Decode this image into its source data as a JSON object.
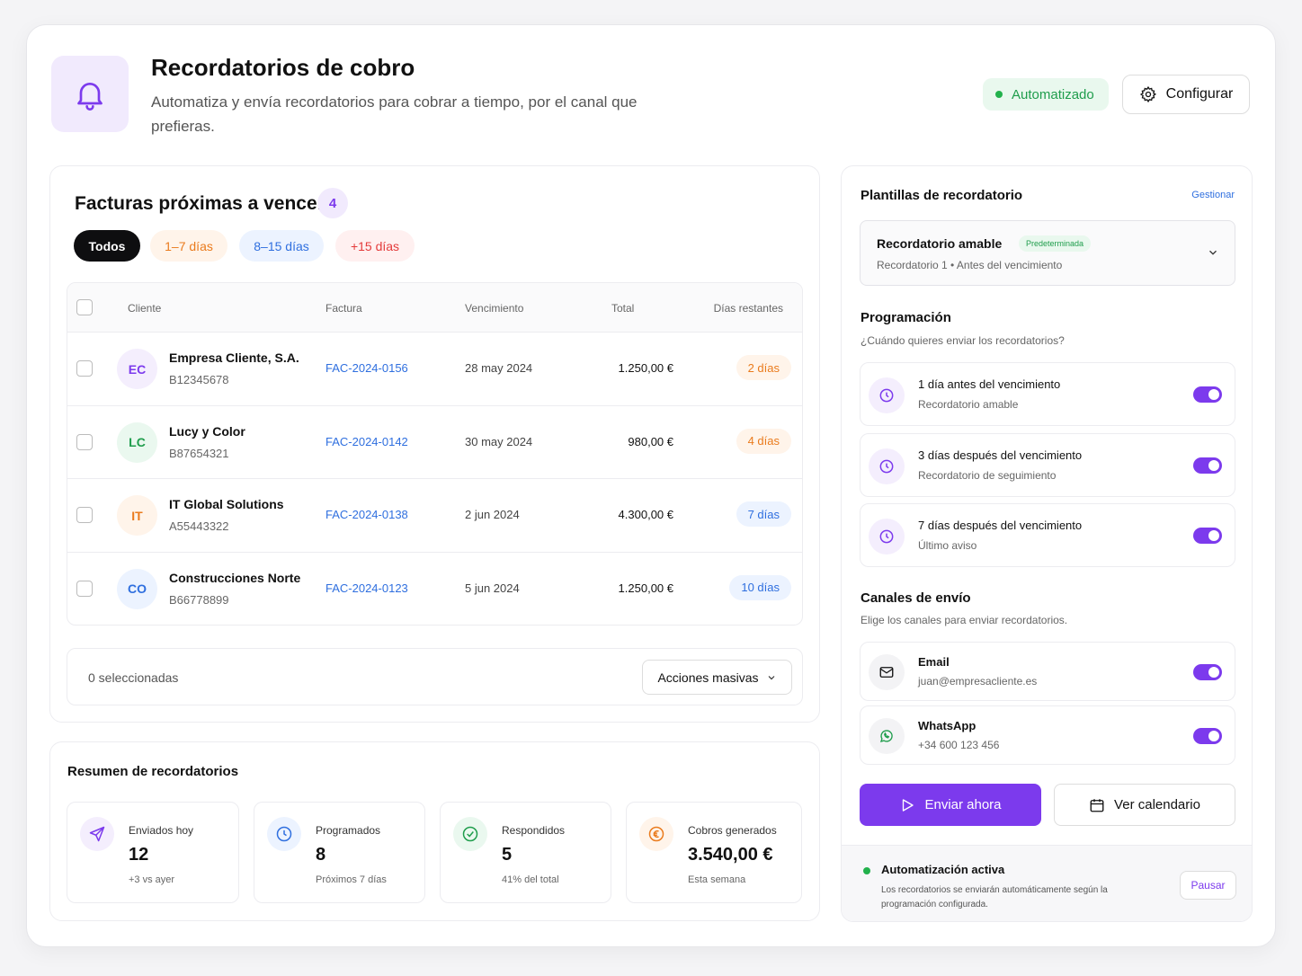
{
  "header": {
    "title": "Recordatorios de cobro",
    "subtitle": "Automatiza y envía recordatorios para cobrar a tiempo, por el canal que prefieras.",
    "status_badge": "Automatizado",
    "config_label": "Configurar"
  },
  "invoices": {
    "title": "Facturas próximas a vencer",
    "count": "4",
    "filters": [
      "Todos",
      "1–7 días",
      "8–15 días",
      "+15 días"
    ],
    "columns": [
      "Cliente",
      "Factura",
      "Vencimiento",
      "Total",
      "Días restantes"
    ],
    "rows": [
      {
        "initials": "EC",
        "name": "Empresa Cliente, S.A.",
        "cif": "B12345678",
        "invoice": "FAC-2024-0156",
        "due": "28 may 2024",
        "total": "1.250,00 €",
        "days": "2 días"
      },
      {
        "initials": "LC",
        "name": "Lucy y Color",
        "cif": "B87654321",
        "invoice": "FAC-2024-0142",
        "due": "30 may 2024",
        "total": "980,00 €",
        "days": "4 días"
      },
      {
        "initials": "IT",
        "name": "IT Global Solutions",
        "cif": "A55443322",
        "invoice": "FAC-2024-0138",
        "due": "2 jun 2024",
        "total": "4.300,00 €",
        "days": "7 días"
      },
      {
        "initials": "CO",
        "name": "Construcciones Norte",
        "cif": "B66778899",
        "invoice": "FAC-2024-0123",
        "due": "5 jun 2024",
        "total": "1.250,00 €",
        "days": "10 días"
      }
    ],
    "selected_text": "0 seleccionadas",
    "bulk_label": "Acciones masivas"
  },
  "summary": {
    "title": "Resumen de recordatorios",
    "stats": [
      {
        "label": "Enviados hoy",
        "value": "12",
        "sub": "+3 vs ayer"
      },
      {
        "label": "Programados",
        "value": "8",
        "sub": "Próximos 7 días"
      },
      {
        "label": "Respondidos",
        "value": "5",
        "sub": "41% del total"
      },
      {
        "label": "Cobros generados",
        "value": "3.540,00 €",
        "sub": "Esta semana"
      }
    ]
  },
  "templates": {
    "title": "Plantillas de recordatorio",
    "manage_label": "Gestionar",
    "selected_name": "Recordatorio amable",
    "selected_badge": "Predeterminada",
    "selected_desc": "Recordatorio 1 • Antes del vencimiento"
  },
  "schedule": {
    "title": "Programación",
    "subtitle": "¿Cuándo quieres enviar los recordatorios?",
    "items": [
      {
        "when": "1 día antes del vencimiento",
        "template": "Recordatorio amable",
        "enabled": true
      },
      {
        "when": "3 días después del vencimiento",
        "template": "Recordatorio de seguimiento",
        "enabled": true
      },
      {
        "when": "7 días después del vencimiento",
        "template": "Último aviso",
        "enabled": true
      }
    ]
  },
  "channels": {
    "title": "Canales de envío",
    "subtitle": "Elige los canales para enviar recordatorios.",
    "items": [
      {
        "name": "Email",
        "detail": "juan@empresacliente.es",
        "enabled": true,
        "icon": "mail-icon"
      },
      {
        "name": "WhatsApp",
        "detail": "+34 600 123 456",
        "enabled": true,
        "icon": "whatsapp-icon"
      }
    ]
  },
  "actions": {
    "send_label": "Enviar ahora",
    "calendar_label": "Ver calendario"
  },
  "automation": {
    "title": "Automatización activa",
    "desc": "Los recordatorios se enviarán automáticamente según la programación configurada.",
    "pause_label": "Pausar"
  },
  "colors": {
    "accent": "#7c3aed",
    "success": "#22b14c",
    "link": "#2f6fdf"
  }
}
